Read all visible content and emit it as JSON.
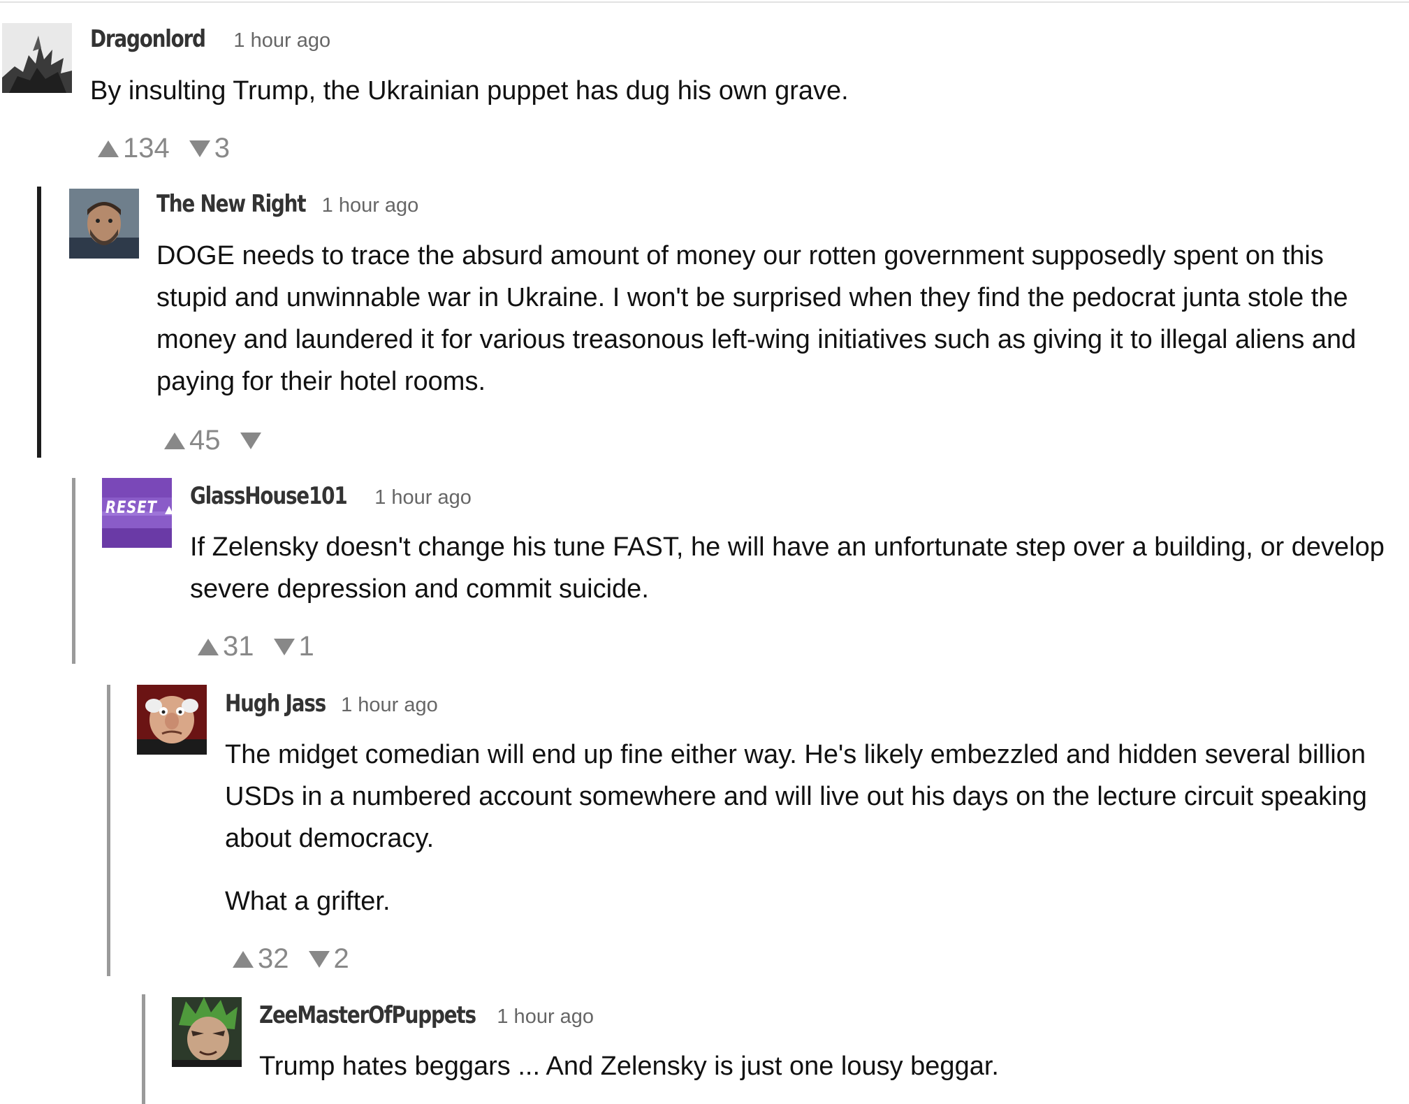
{
  "colors": {
    "text": "#111111",
    "username": "#333333",
    "timestamp": "#666666",
    "vote": "#888888",
    "thread_line_primary": "#1c1c1c",
    "thread_line_nested": "#9a9a9a"
  },
  "comments": [
    {
      "username": "Dragonlord",
      "time": "1 hour ago",
      "avatar_icon": "dragon-avatar",
      "paragraphs": [
        "By insulting Trump, the Ukrainian puppet has dug his own grave."
      ],
      "upvotes": "134",
      "downvotes": "3"
    },
    {
      "username": "The New Right",
      "time": "1 hour ago",
      "avatar_icon": "man-portrait-avatar",
      "paragraphs": [
        "DOGE needs to trace the absurd amount of money our rotten government supposedly spent on this stupid and unwinnable war in Ukraine.  I won't be surprised when they find the pedocrat junta stole the money and laundered it for various treasonous left-wing initiatives such as giving it to illegal aliens and paying for their hotel rooms."
      ],
      "upvotes": "45",
      "downvotes": ""
    },
    {
      "username": "GlassHouse101",
      "time": "1 hour ago",
      "avatar_icon": "reset-button-avatar",
      "avatar_text": "RESET",
      "paragraphs": [
        "If Zelensky doesn't change his tune FAST, he will have an unfortunate step over a building, or develop severe depression and commit suicide."
      ],
      "upvotes": "31",
      "downvotes": "1"
    },
    {
      "username": "Hugh Jass",
      "time": "1 hour ago",
      "avatar_icon": "muppet-old-man-avatar",
      "paragraphs": [
        "The midget comedian will end up fine either way. He's likely embezzled and hidden several billion USDs in a numbered account somewhere and will live out his days on the lecture circuit speaking about democracy.",
        "What a grifter."
      ],
      "upvotes": "32",
      "downvotes": "2"
    },
    {
      "username": "ZeeMasterOfPuppets",
      "time": "1 hour ago",
      "avatar_icon": "anime-character-avatar",
      "paragraphs": [
        "Trump hates beggars ... And Zelensky is just one lousy beggar."
      ]
    }
  ]
}
